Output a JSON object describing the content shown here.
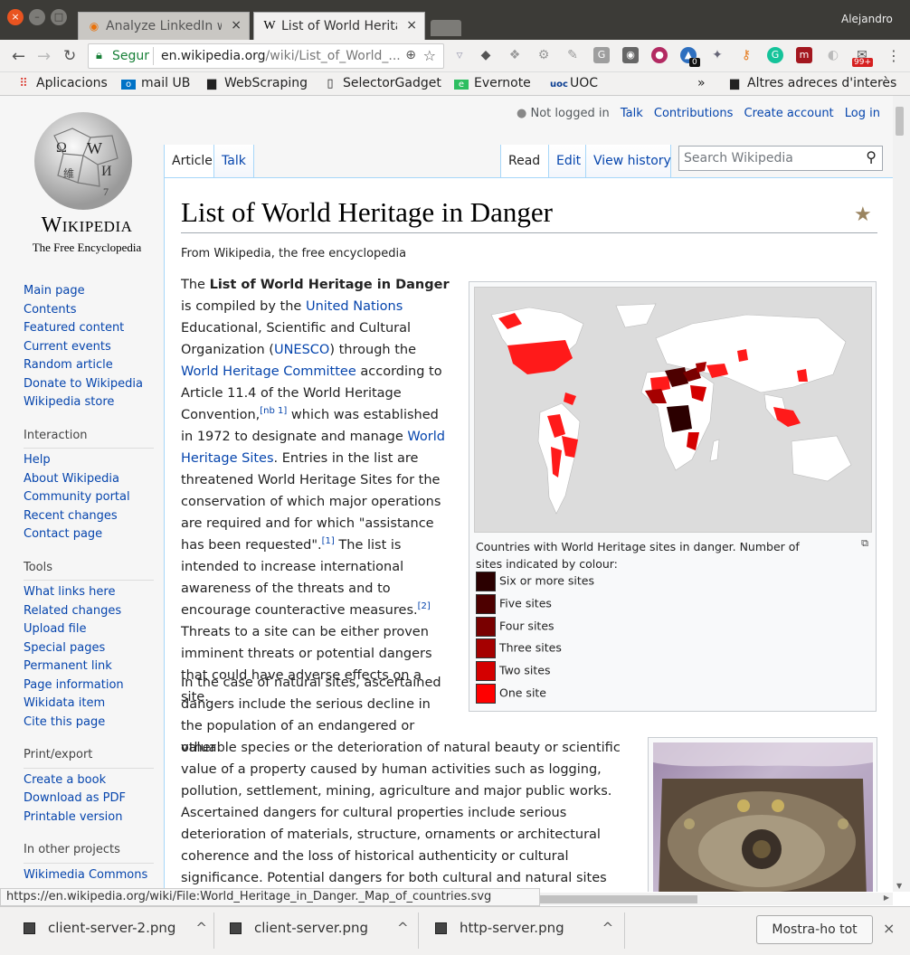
{
  "browser": {
    "tabs": [
      {
        "title": "Analyze LinkedIn w",
        "close": "×"
      },
      {
        "title": "List of World Herita",
        "close": "×"
      }
    ],
    "user": "Alejandro",
    "address": {
      "security": "Segur",
      "host": "en.wikipedia.org",
      "path": "/wiki/List_of_World_..."
    },
    "bookmarks": [
      "Aplicacions",
      "mail UB",
      "WebScraping",
      "SelectorGadget",
      "Evernote",
      "UOC"
    ],
    "bookmarks_more": "»",
    "bookmarks_other": "Altres adreces d'interès",
    "ext_badges": {
      "count": "0",
      "mail": "99+"
    }
  },
  "wiki": {
    "personal": {
      "status": "Not logged in",
      "links": [
        "Talk",
        "Contributions",
        "Create account",
        "Log in"
      ]
    },
    "logo": {
      "wordmark": "Wikipedia",
      "tagline": "The Free Encyclopedia"
    },
    "nav": [
      "Main page",
      "Contents",
      "Featured content",
      "Current events",
      "Random article",
      "Donate to Wikipedia",
      "Wikipedia store"
    ],
    "sections": [
      {
        "title": "Interaction",
        "items": [
          "Help",
          "About Wikipedia",
          "Community portal",
          "Recent changes",
          "Contact page"
        ]
      },
      {
        "title": "Tools",
        "items": [
          "What links here",
          "Related changes",
          "Upload file",
          "Special pages",
          "Permanent link",
          "Page information",
          "Wikidata item",
          "Cite this page"
        ]
      },
      {
        "title": "Print/export",
        "items": [
          "Create a book",
          "Download as PDF",
          "Printable version"
        ]
      },
      {
        "title": "In other projects",
        "items": [
          "Wikimedia Commons"
        ]
      }
    ],
    "tabs_left": [
      "Article",
      "Talk"
    ],
    "tabs_right": [
      "Read",
      "Edit",
      "View history"
    ],
    "search_placeholder": "Search Wikipedia",
    "title": "List of World Heritage in Danger",
    "sitesub": "From Wikipedia, the free encyclopedia",
    "map_caption": "Countries with World Heritage sites in danger. Number of sites indicated by colour:",
    "legend": [
      {
        "label": "Six or more sites",
        "color": "#2b0000"
      },
      {
        "label": "Five sites",
        "color": "#4d0000"
      },
      {
        "label": "Four sites",
        "color": "#790000"
      },
      {
        "label": "Three sites",
        "color": "#a50000"
      },
      {
        "label": "Two sites",
        "color": "#d40000"
      },
      {
        "label": "One site",
        "color": "#ff0000"
      }
    ],
    "p1": {
      "t1": "The ",
      "b1": "List of World Heritage in Danger",
      "t2": " is compiled by the ",
      "a1": "United Nations",
      "t3": " Educational, Scientific and Cultural Organization (",
      "a2": "UNESCO",
      "t4": ") through the ",
      "a3": "World Heritage Committee",
      "t5": " according to Article 11.4 of the World Heritage Convention,",
      "s1": "[nb 1]",
      "t6": " which was established in 1972 to designate and manage ",
      "a4": "World Heritage Sites",
      "t7": ". Entries in the list are threatened World Heritage Sites for the conservation of which major operations are required and for which \"assistance has been requested\".",
      "s2": "[1]",
      "t8": " The list is intended to increase international awareness of the threats and to encourage counteractive measures.",
      "s3": "[2]",
      "t9": " Threats to a site can be either proven imminent threats or potential dangers that could have adverse effects on a site."
    },
    "p2a": "In the case of natural sites, ascertained dangers include the serious decline in the population of an endangered or other",
    "p2b": "valuable species or the deterioration of natural beauty or scientific value of a property caused by human activities such as logging, pollution, settlement, mining, agriculture and major public works. Ascertained dangers for cultural properties include serious deterioration of materials, structure, ornaments or architectural coherence and the loss of historical authenticity or cultural significance. Potential dangers for both cultural and natural sites include development projects, armed conflicts,"
  },
  "status_url": "https://en.wikipedia.org/wiki/File:World_Heritage_in_Danger._Map_of_countries.svg",
  "downloads": {
    "files": [
      "client-server-2.png",
      "client-server.png",
      "http-server.png"
    ],
    "caret": "^",
    "show_all": "Mostra-ho tot",
    "close": "×"
  }
}
